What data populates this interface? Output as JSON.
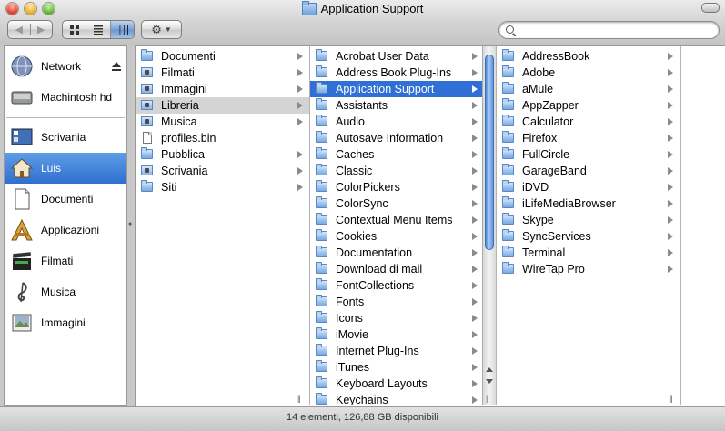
{
  "window": {
    "title": "Application Support"
  },
  "toolbar": {
    "back_icon": "back-arrow-icon",
    "forward_icon": "forward-arrow-icon",
    "views": [
      "icon-view-icon",
      "list-view-icon",
      "column-view-icon"
    ],
    "active_view": "column",
    "action_icon": "gear-icon",
    "search": {
      "value": "",
      "placeholder": ""
    }
  },
  "sidebar": {
    "items": [
      {
        "label": "Network",
        "icon": "network-globe-icon",
        "eject": true
      },
      {
        "label": "Machintosh hd",
        "icon": "hard-disk-icon"
      },
      {
        "label": "Scrivania",
        "icon": "desktop-icon"
      },
      {
        "label": "Luis",
        "icon": "home-icon",
        "selected": true
      },
      {
        "label": "Documenti",
        "icon": "document-icon"
      },
      {
        "label": "Applicazioni",
        "icon": "applications-icon"
      },
      {
        "label": "Filmati",
        "icon": "movie-clapper-icon"
      },
      {
        "label": "Musica",
        "icon": "music-note-icon"
      },
      {
        "label": "Immagini",
        "icon": "pictures-icon"
      }
    ]
  },
  "columns": [
    {
      "items": [
        {
          "name": "Documenti",
          "type": "folder",
          "arrow": true
        },
        {
          "name": "Filmati",
          "type": "special",
          "arrow": true
        },
        {
          "name": "Immagini",
          "type": "special",
          "arrow": true
        },
        {
          "name": "Libreria",
          "type": "special",
          "arrow": true,
          "state": "path"
        },
        {
          "name": "Musica",
          "type": "special",
          "arrow": true
        },
        {
          "name": "profiles.bin",
          "type": "file",
          "arrow": false
        },
        {
          "name": "Pubblica",
          "type": "folder",
          "arrow": true
        },
        {
          "name": "Scrivania",
          "type": "special",
          "arrow": true
        },
        {
          "name": "Siti",
          "type": "folder",
          "arrow": true
        }
      ]
    },
    {
      "items": [
        {
          "name": "Acrobat User Data",
          "type": "folder",
          "arrow": true
        },
        {
          "name": "Address Book Plug-Ins",
          "type": "folder",
          "arrow": true
        },
        {
          "name": "Application Support",
          "type": "folder",
          "arrow": true,
          "state": "selected"
        },
        {
          "name": "Assistants",
          "type": "folder",
          "arrow": true
        },
        {
          "name": "Audio",
          "type": "folder",
          "arrow": true
        },
        {
          "name": "Autosave Information",
          "type": "folder",
          "arrow": true
        },
        {
          "name": "Caches",
          "type": "folder",
          "arrow": true
        },
        {
          "name": "Classic",
          "type": "folder",
          "arrow": true
        },
        {
          "name": "ColorPickers",
          "type": "folder",
          "arrow": true
        },
        {
          "name": "ColorSync",
          "type": "folder",
          "arrow": true
        },
        {
          "name": "Contextual Menu Items",
          "type": "folder",
          "arrow": true
        },
        {
          "name": "Cookies",
          "type": "folder",
          "arrow": true
        },
        {
          "name": "Documentation",
          "type": "folder",
          "arrow": true
        },
        {
          "name": "Download di mail",
          "type": "folder",
          "arrow": true
        },
        {
          "name": "FontCollections",
          "type": "folder",
          "arrow": true
        },
        {
          "name": "Fonts",
          "type": "folder",
          "arrow": true
        },
        {
          "name": "Icons",
          "type": "folder",
          "arrow": true
        },
        {
          "name": "iMovie",
          "type": "folder",
          "arrow": true
        },
        {
          "name": "Internet Plug-Ins",
          "type": "folder",
          "arrow": true
        },
        {
          "name": "iTunes",
          "type": "folder",
          "arrow": true
        },
        {
          "name": "Keyboard Layouts",
          "type": "folder",
          "arrow": true
        },
        {
          "name": "Keychains",
          "type": "folder",
          "arrow": true
        }
      ]
    },
    {
      "items": [
        {
          "name": "AddressBook",
          "type": "folder",
          "arrow": true
        },
        {
          "name": "Adobe",
          "type": "folder",
          "arrow": true
        },
        {
          "name": "aMule",
          "type": "folder",
          "arrow": true
        },
        {
          "name": "AppZapper",
          "type": "folder",
          "arrow": true
        },
        {
          "name": "Calculator",
          "type": "folder",
          "arrow": true
        },
        {
          "name": "Firefox",
          "type": "folder",
          "arrow": true
        },
        {
          "name": "FullCircle",
          "type": "folder",
          "arrow": true
        },
        {
          "name": "GarageBand",
          "type": "folder",
          "arrow": true
        },
        {
          "name": "iDVD",
          "type": "folder",
          "arrow": true
        },
        {
          "name": "iLifeMediaBrowser",
          "type": "folder",
          "arrow": true
        },
        {
          "name": "Skype",
          "type": "folder",
          "arrow": true
        },
        {
          "name": "SyncServices",
          "type": "folder",
          "arrow": true
        },
        {
          "name": "Terminal",
          "type": "folder",
          "arrow": true
        },
        {
          "name": "WireTap Pro",
          "type": "folder",
          "arrow": true
        }
      ]
    }
  ],
  "status": {
    "text": "14 elementi, 126,88 GB disponibili"
  },
  "colors": {
    "selection": "#2f6fd6",
    "path_highlight": "#d4d4d4",
    "sidebar_selection": "#3d7fd8"
  }
}
